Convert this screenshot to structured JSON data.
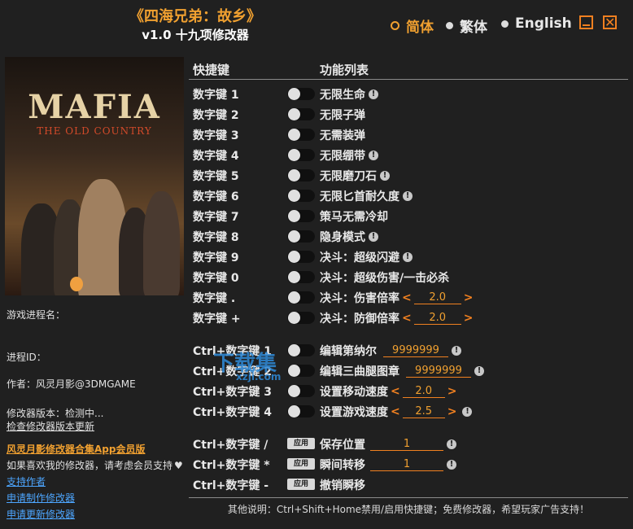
{
  "app": {
    "title_line1": "《四海兄弟：故乡》",
    "title_line2": "v1.0 十九项修改器"
  },
  "lang": [
    {
      "label": "简体",
      "selected": true
    },
    {
      "label": "繁体",
      "selected": false
    },
    {
      "label": "English",
      "selected": false
    }
  ],
  "cover": {
    "logo": "MAFIA",
    "sub": "THE OLD COUNTRY"
  },
  "left": {
    "process_name": "游戏进程名：",
    "process_id": "进程ID：",
    "author": "作者：风灵月影@3DMGAME",
    "version": "修改器版本：检测中...",
    "check_update": "检查修改器版本更新",
    "membership": "风灵月影修改器合集App会员版",
    "support_text": "如果喜欢我的修改器，请考虑会员支持",
    "heart": "♥",
    "link_support": "支持作者",
    "link_request": "申请制作修改器",
    "link_update": "申请更新修改器"
  },
  "header": {
    "hotkey": "快捷键",
    "functions": "功能列表"
  },
  "rows": [
    {
      "key": "数字键 1",
      "label": "无限生命",
      "info": true
    },
    {
      "key": "数字键 2",
      "label": "无限子弹",
      "info": false
    },
    {
      "key": "数字键 3",
      "label": "无需装弹",
      "info": false
    },
    {
      "key": "数字键 4",
      "label": "无限绷带",
      "info": true
    },
    {
      "key": "数字键 5",
      "label": "无限磨刀石",
      "info": true
    },
    {
      "key": "数字键 6",
      "label": "无限匕首耐久度",
      "info": true
    },
    {
      "key": "数字键 7",
      "label": "策马无需冷却",
      "info": false
    },
    {
      "key": "数字键 8",
      "label": "隐身模式",
      "info": true
    },
    {
      "key": "数字键 9",
      "label": "决斗：超级闪避",
      "info": true
    },
    {
      "key": "数字键 0",
      "label": "决斗：超级伤害/一击必杀",
      "info": false
    },
    {
      "key": "数字键 .",
      "label": "决斗：伤害倍率",
      "value": "2.0"
    },
    {
      "key": "数字键 +",
      "label": "决斗：防御倍率",
      "value": "2.0"
    }
  ],
  "ctrl_rows": [
    {
      "key": "Ctrl+数字键 1",
      "label": "编辑第纳尔",
      "value": "9999999",
      "info": true
    },
    {
      "key": "Ctrl+数字键 2",
      "label": "编辑三曲腿图章",
      "value": "9999999",
      "info": true
    },
    {
      "key": "Ctrl+数字键 3",
      "label": "设置移动速度",
      "value": "2.0",
      "info": false
    },
    {
      "key": "Ctrl+数字键 4",
      "label": "设置游戏速度",
      "value": "2.5",
      "info": true
    }
  ],
  "apply_rows": [
    {
      "key": "Ctrl+数字键 /",
      "button": "应用",
      "label": "保存位置",
      "value": "1",
      "info": true
    },
    {
      "key": "Ctrl+数字键 *",
      "button": "应用",
      "label": "瞬间转移",
      "value": "1",
      "info": true
    },
    {
      "key": "Ctrl+数字键 -",
      "button": "应用",
      "label": "撤销瞬移",
      "info": false
    }
  ],
  "watermark": {
    "text": "下载集",
    "sub": "xzji.com"
  },
  "footer": "其他说明：Ctrl+Shift+Home禁用/启用快捷键；免费修改器，希望玩家广告支持！",
  "arrows": {
    "left": "<",
    "right": ">"
  },
  "info_glyph": "!",
  "close_glyph": "✕"
}
